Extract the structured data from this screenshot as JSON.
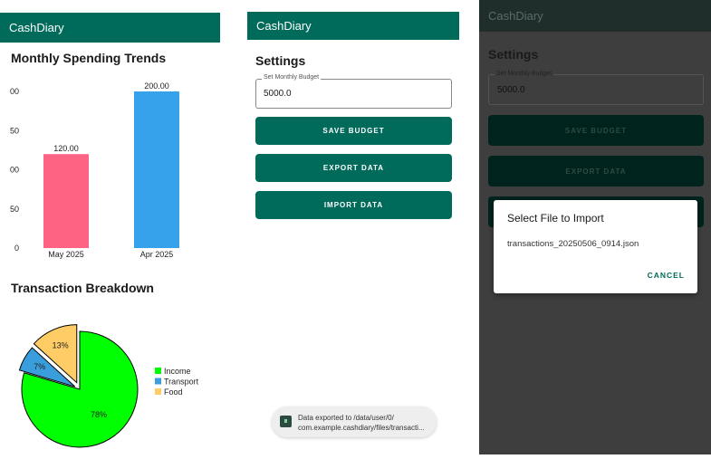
{
  "app": {
    "title": "CashDiary"
  },
  "screen1": {
    "chart_title": "Monthly Spending Trends",
    "breakdown_title": "Transaction Breakdown"
  },
  "chart_data": [
    {
      "type": "bar",
      "categories": [
        "May 2025",
        "Apr 2025"
      ],
      "values": [
        120.0,
        200.0
      ],
      "value_labels": [
        "120.00",
        "200.00"
      ],
      "colors": [
        "#ff6384",
        "#36a2eb"
      ],
      "y_tick_labels": [
        "0",
        "50",
        "00",
        "50",
        "00"
      ],
      "ylim": [
        0,
        200
      ]
    },
    {
      "type": "pie",
      "labels": [
        "Income",
        "Transport",
        "Food"
      ],
      "values": [
        78,
        7,
        13
      ],
      "value_labels": [
        "78%",
        "7%",
        "13%"
      ],
      "colors": [
        "#00ff00",
        "#3b9edc",
        "#ffcc66"
      ],
      "legend_position": "right"
    }
  ],
  "screen2": {
    "title": "Settings",
    "budget_label": "Set Monthly Budget",
    "budget_value": "5000.0",
    "save_label": "SAVE BUDGET",
    "export_label": "EXPORT DATA",
    "import_label": "IMPORT DATA",
    "toast_line1": "Data exported to /data/user/0/",
    "toast_line2": "com.example.cashdiary/files/transacti..."
  },
  "screen3": {
    "dialog_title": "Select File to Import",
    "dialog_file": "transactions_20250506_0914.json",
    "cancel_label": "CANCEL"
  }
}
